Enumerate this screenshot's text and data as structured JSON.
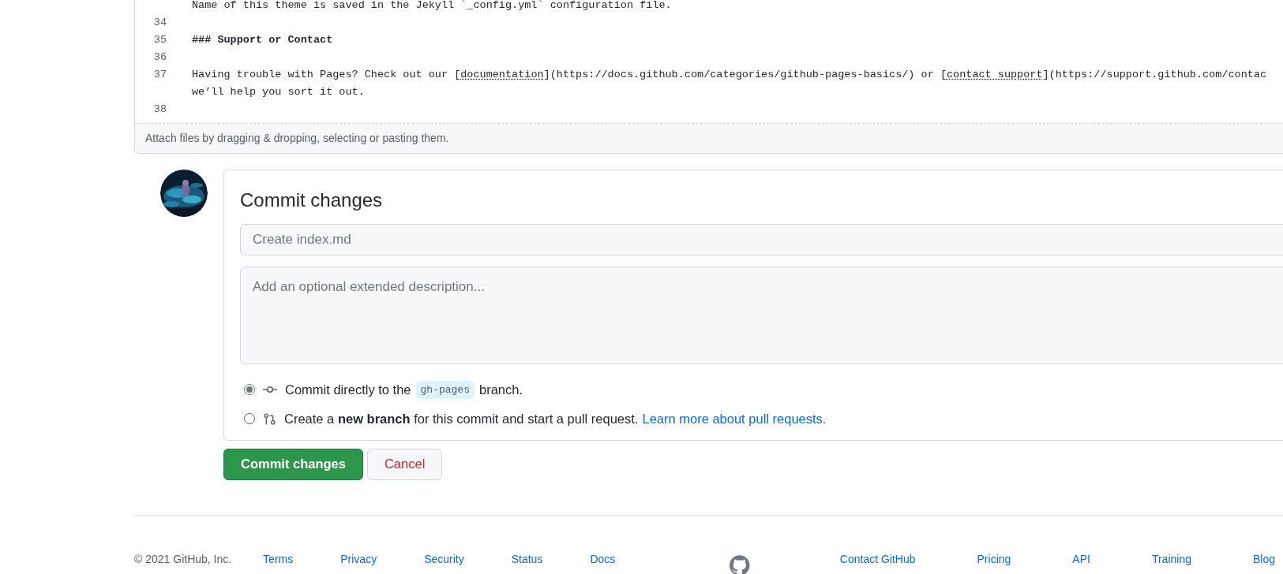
{
  "editor": {
    "lines": [
      {
        "segments": [
          {
            "kind": "text",
            "text": "Name of this theme is saved in the Jekyll `_config.yml` configuration file."
          }
        ]
      },
      {
        "number": "34"
      },
      {
        "number": "35",
        "segments": [
          {
            "kind": "bold",
            "text": "### Support or Contact"
          }
        ]
      },
      {
        "number": "36"
      },
      {
        "number": "37",
        "segments": [
          {
            "kind": "text",
            "text": "Having trouble with Pages? Check out our ["
          },
          {
            "kind": "link",
            "text": "documentation"
          },
          {
            "kind": "text",
            "text": "](https://docs.github.com/categories/github-pages-basics/) or ["
          },
          {
            "kind": "link",
            "text": "contact support"
          },
          {
            "kind": "text",
            "text": "](https://support.github.com/contac"
          }
        ],
        "wrap": "we’ll help you sort it out."
      },
      {
        "number": "38"
      }
    ],
    "attach_hint": "Attach files by dragging & dropping, selecting or pasting them."
  },
  "commit": {
    "title": "Commit changes",
    "summary": {
      "placeholder": "Create index.md"
    },
    "description": {
      "placeholder": "Add an optional extended description..."
    },
    "options": [
      {
        "kind": "commit",
        "selected": true,
        "before": "Commit directly to the",
        "branch": "gh-pages",
        "after": "branch."
      },
      {
        "kind": "pull-request",
        "selected": false,
        "before": "Create a",
        "bold": "new branch",
        "after": "for this commit and start a pull request.",
        "link": "Learn more about pull requests."
      }
    ],
    "buttons": [
      {
        "kind": "primary",
        "label": "Commit changes"
      },
      {
        "kind": "cancel",
        "label": "Cancel"
      }
    ]
  },
  "footer": {
    "copyright": "© 2021 GitHub, Inc.",
    "left_links": [
      "Terms",
      "Privacy",
      "Security",
      "Status",
      "Docs"
    ],
    "right_links": [
      "Contact GitHub",
      "Pricing",
      "API",
      "Training",
      "Blog"
    ]
  }
}
